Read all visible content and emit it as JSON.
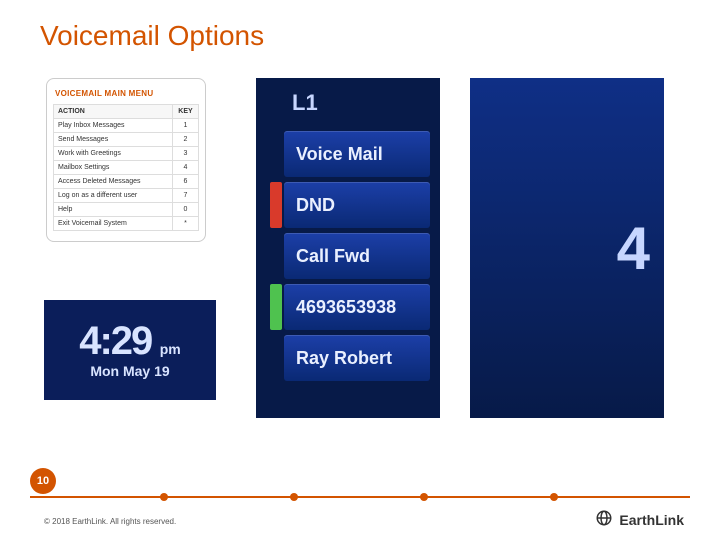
{
  "title": "Voicemail Options",
  "menu": {
    "heading": "VOICEMAIL MAIN MENU",
    "col_action": "ACTION",
    "col_key": "KEY",
    "rows": [
      {
        "action": "Play Inbox Messages",
        "key": "1"
      },
      {
        "action": "Send Messages",
        "key": "2"
      },
      {
        "action": "Work with Greetings",
        "key": "3"
      },
      {
        "action": "Mailbox Settings",
        "key": "4"
      },
      {
        "action": "Access Deleted Messages",
        "key": "6"
      },
      {
        "action": "Log on as a different user",
        "key": "7"
      },
      {
        "action": "Help",
        "key": "0"
      },
      {
        "action": "Exit Voicemail System",
        "key": "*"
      }
    ]
  },
  "time_photo": {
    "time": "4:29",
    "ampm": "pm",
    "date": "Mon May 19"
  },
  "phone_menu": {
    "header": "L1",
    "items": [
      {
        "label": "Voice Mail",
        "flag": ""
      },
      {
        "label": "DND",
        "flag": "red"
      },
      {
        "label": "Call Fwd",
        "flag": ""
      },
      {
        "label": "4693653938",
        "flag": "green"
      },
      {
        "label": "Ray Robert",
        "flag": ""
      }
    ]
  },
  "right_photo_glyph": "4",
  "page_number": "10",
  "copyright": "© 2018 EarthLink. All rights reserved.",
  "brand": "EarthLink",
  "colors": {
    "accent": "#d35400",
    "phone_bg": "#071a48"
  }
}
